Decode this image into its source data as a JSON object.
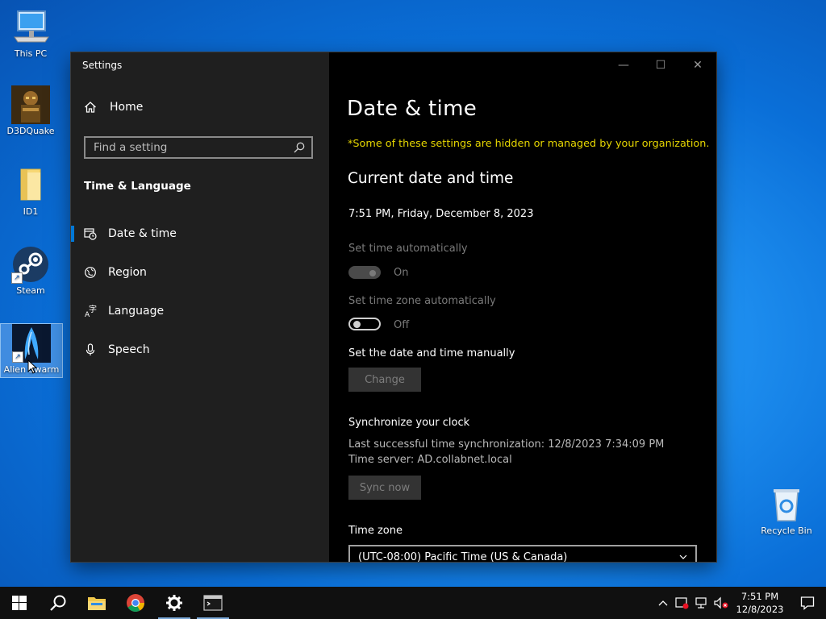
{
  "desktop": {
    "icons": [
      {
        "label": "This PC",
        "icon": "computer-icon"
      },
      {
        "label": "D3DQuake",
        "icon": "quake-icon"
      },
      {
        "label": "ID1",
        "icon": "folder-icon"
      },
      {
        "label": "Steam",
        "icon": "steam-icon"
      },
      {
        "label": "Alien Swarm",
        "icon": "alien-swarm-icon"
      },
      {
        "label": "Recycle Bin",
        "icon": "recycle-bin-icon"
      }
    ]
  },
  "window": {
    "title": "Settings",
    "controls": {
      "minimize": "—",
      "maximize": "☐",
      "close": "✕"
    }
  },
  "sidebar": {
    "home_label": "Home",
    "search_placeholder": "Find a setting",
    "section_title": "Time & Language",
    "items": [
      {
        "label": "Date & time",
        "icon": "calendar-clock-icon",
        "active": true
      },
      {
        "label": "Region",
        "icon": "globe-icon",
        "active": false
      },
      {
        "label": "Language",
        "icon": "language-icon",
        "active": false
      },
      {
        "label": "Speech",
        "icon": "microphone-icon",
        "active": false
      }
    ]
  },
  "main": {
    "title": "Date & time",
    "org_note": "*Some of these settings are hidden or managed by your organization.",
    "current_heading": "Current date and time",
    "current_datetime": "7:51 PM, Friday, December 8, 2023",
    "set_time_auto": {
      "label": "Set time automatically",
      "state": "On"
    },
    "set_tz_auto": {
      "label": "Set time zone automatically",
      "state": "Off"
    },
    "manual": {
      "label": "Set the date and time manually",
      "button": "Change"
    },
    "sync": {
      "heading": "Synchronize your clock",
      "last_sync": "Last successful time synchronization: 12/8/2023 7:34:09 PM",
      "server": "Time server: AD.collabnet.local",
      "button": "Sync now"
    },
    "timezone": {
      "label": "Time zone",
      "value": "(UTC-08:00) Pacific Time (US & Canada)"
    }
  },
  "taskbar": {
    "clock_time": "7:51 PM",
    "clock_date": "12/8/2023",
    "colors": {
      "accent": "#0078d7",
      "org_note": "#e6d600"
    }
  }
}
